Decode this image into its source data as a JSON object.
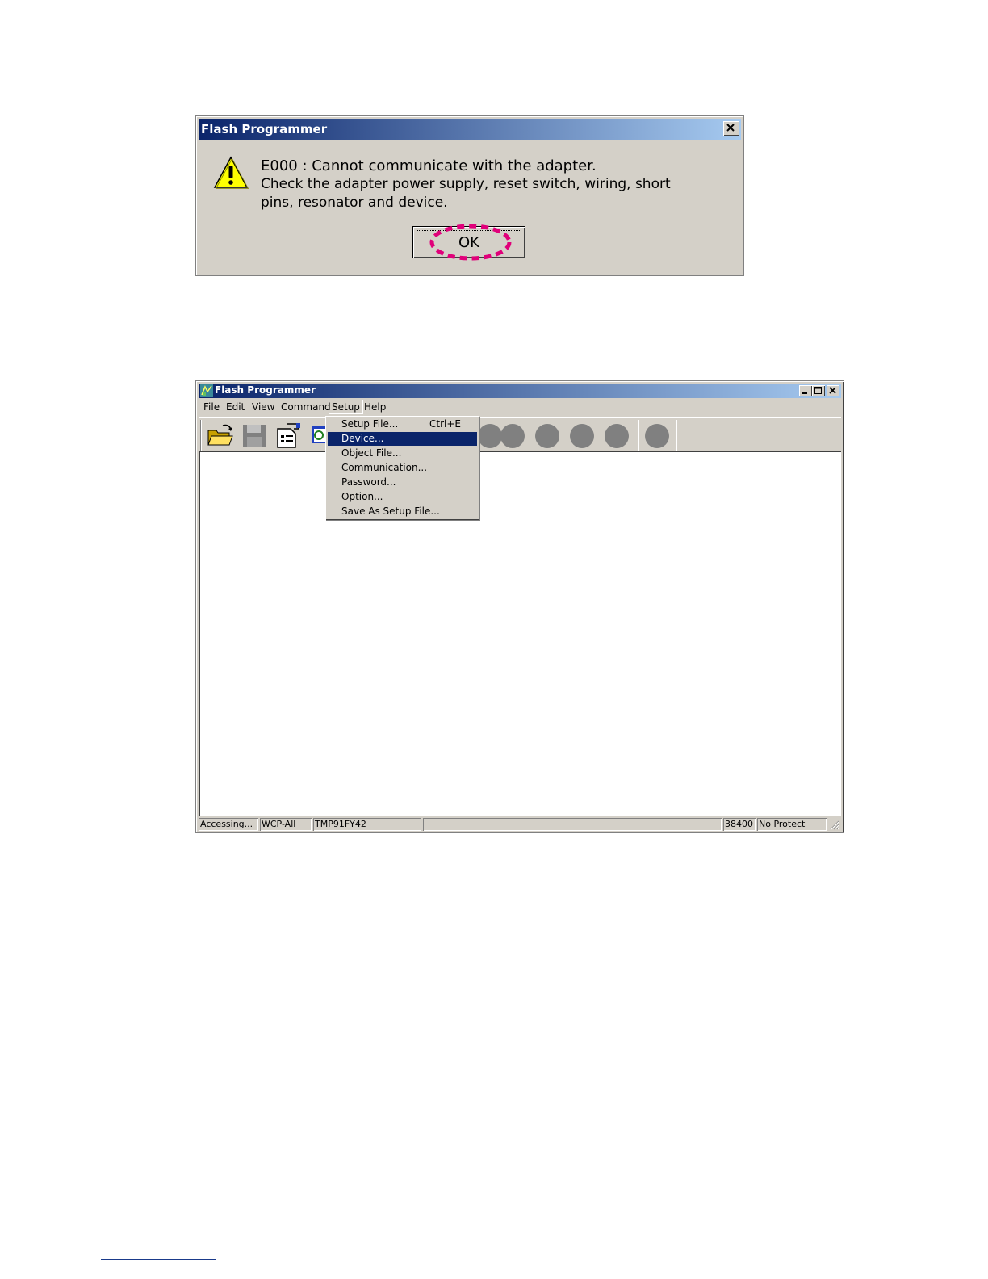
{
  "dialog": {
    "title": "Flash Programmer",
    "message_line1": "E000 : Cannot communicate with the adapter.",
    "message_line2": "Check the adapter power supply, reset switch, wiring, short",
    "message_line3": "pins, resonator and device.",
    "ok_label": "OK",
    "highlight_color": "#e0007a"
  },
  "window": {
    "title": "Flash Programmer",
    "menu": {
      "file": "File",
      "edit": "Edit",
      "view": "View",
      "command": "Command",
      "setup": "Setup",
      "help": "Help"
    },
    "toolbar": {
      "icons": [
        "open-folder-icon",
        "save-disk-icon",
        "setup-file-icon",
        "device-monitor-icon"
      ]
    },
    "setup_menu": {
      "items": [
        {
          "label": "Setup File...",
          "shortcut": "Ctrl+E"
        },
        {
          "label": "Device..."
        },
        {
          "label": "Object File..."
        },
        {
          "label": "Communication..."
        },
        {
          "label": "Password..."
        },
        {
          "label": "Option..."
        },
        {
          "label": "Save As Setup File..."
        }
      ],
      "highlighted": "Device...",
      "highlight_color": "#0a246a"
    },
    "status": {
      "state": "Accessing...",
      "adapter": "WCP-All",
      "device": "TMP91FY42",
      "empty": "",
      "baud": "38400",
      "protect": "No Protect"
    }
  }
}
